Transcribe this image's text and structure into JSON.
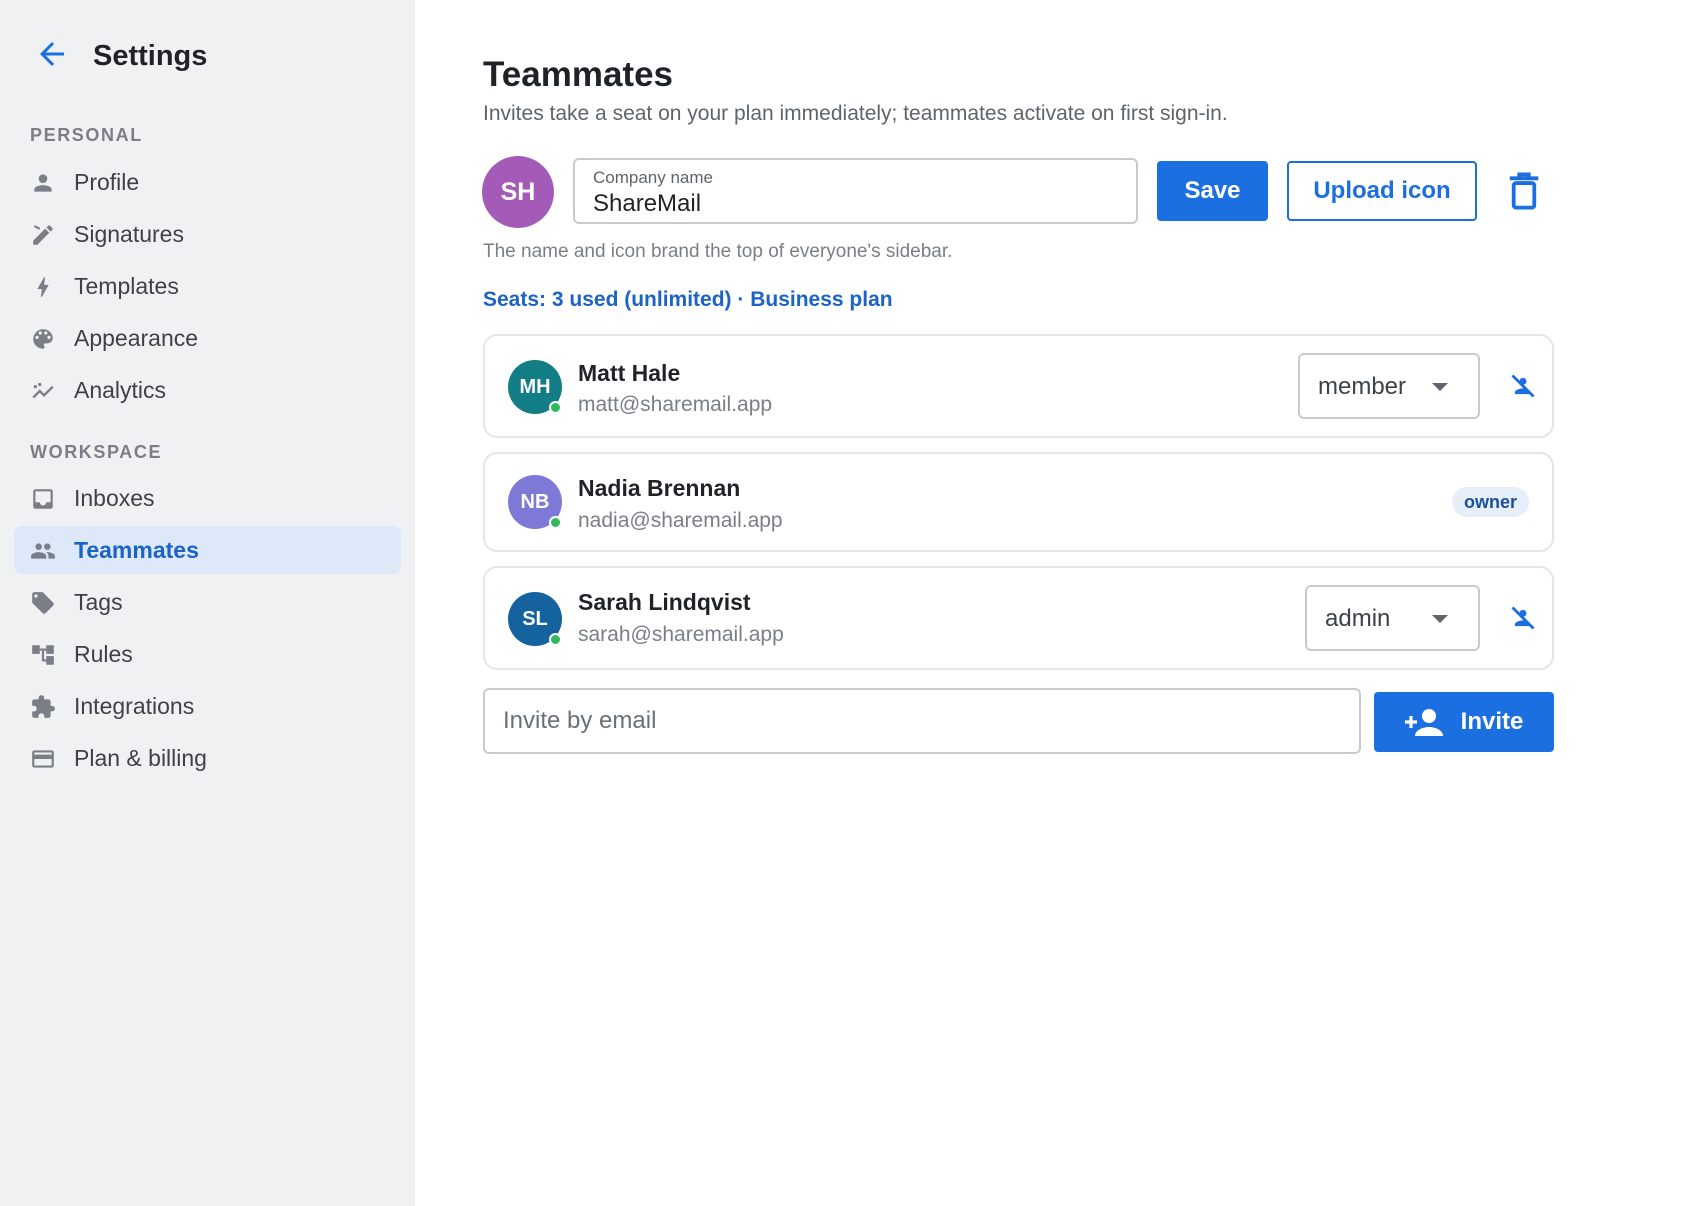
{
  "sidebar": {
    "title": "Settings",
    "sections": [
      {
        "label": "PERSONAL",
        "items": [
          {
            "label": "Profile",
            "icon": "person-icon"
          },
          {
            "label": "Signatures",
            "icon": "signature-icon"
          },
          {
            "label": "Templates",
            "icon": "bolt-icon"
          },
          {
            "label": "Appearance",
            "icon": "palette-icon"
          },
          {
            "label": "Analytics",
            "icon": "analytics-icon"
          }
        ]
      },
      {
        "label": "WORKSPACE",
        "items": [
          {
            "label": "Inboxes",
            "icon": "inbox-icon"
          },
          {
            "label": "Teammates",
            "icon": "people-icon",
            "active": true
          },
          {
            "label": "Tags",
            "icon": "tag-icon"
          },
          {
            "label": "Rules",
            "icon": "rules-icon"
          },
          {
            "label": "Integrations",
            "icon": "puzzle-icon"
          },
          {
            "label": "Plan & billing",
            "icon": "credit-card-icon"
          }
        ]
      }
    ]
  },
  "main": {
    "title": "Teammates",
    "subtitle": "Invites take a seat on your plan immediately; teammates activate on first sign-in.",
    "brand": {
      "avatar_initials": "SH",
      "field_label": "Company name",
      "field_value": "ShareMail",
      "save_label": "Save",
      "upload_label": "Upload icon",
      "hint": "The name and icon brand the top of everyone's sidebar."
    },
    "seats_text": "Seats: 3 used (unlimited) · Business plan",
    "members": [
      {
        "initials": "MH",
        "name": "Matt Hale",
        "email": "matt@sharemail.app",
        "role": "member",
        "avatar_color": "#137d86"
      },
      {
        "initials": "NB",
        "name": "Nadia Brennan",
        "email": "nadia@sharemail.app",
        "badge": "owner",
        "avatar_color": "#7e78d6"
      },
      {
        "initials": "SL",
        "name": "Sarah Lindqvist",
        "email": "sarah@sharemail.app",
        "role": "admin",
        "avatar_color": "#14639e"
      }
    ],
    "invite": {
      "placeholder": "Invite by email",
      "button_label": "Invite"
    }
  },
  "colors": {
    "accent": "#1c6fe0",
    "sidebar_bg": "#f0f1f3",
    "active_bg": "#dde8f9",
    "online": "#2dbb5b"
  }
}
